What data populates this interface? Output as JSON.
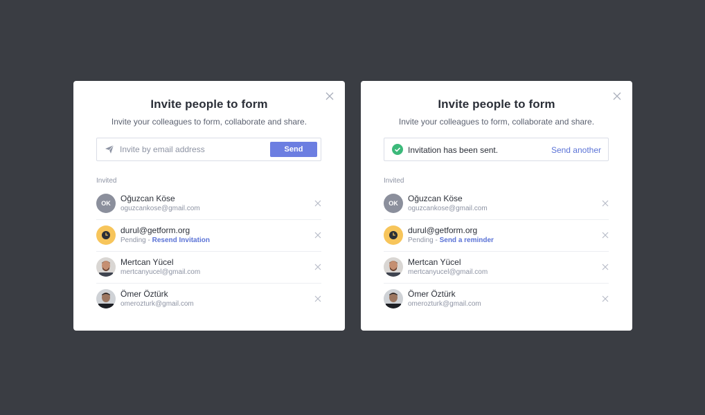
{
  "colors": {
    "background": "#3a3d43",
    "accent": "#6c7ee1",
    "link": "#5b73d6",
    "success": "#3cb97a",
    "pending": "#f7c55b"
  },
  "left_modal": {
    "title": "Invite people to form",
    "subtitle": "Invite your colleagues to form, collaborate and share.",
    "email_placeholder": "Invite by email address",
    "email_value": "",
    "send_label": "Send",
    "invited_label": "Invited",
    "members": [
      {
        "initials": "OK",
        "name": "Oğuzcan Köse",
        "email": "oguzcankose@gmail.com",
        "avatar": "initials"
      },
      {
        "name": "durul@getform.org",
        "status": "Pending",
        "separator": " - ",
        "action": "Resend Invitation",
        "avatar": "clock-icon"
      },
      {
        "name": "Mertcan Yücel",
        "email": "mertcanyucel@gmail.com",
        "avatar": "photo"
      },
      {
        "name": "Ömer Öztürk",
        "email": "omerozturk@gmail.com",
        "avatar": "photo"
      }
    ]
  },
  "right_modal": {
    "title": "Invite people to form",
    "subtitle": "Invite your colleagues to form, collaborate and share.",
    "success_message": "Invitation has been sent.",
    "send_another_label": "Send another",
    "invited_label": "Invited",
    "members": [
      {
        "initials": "OK",
        "name": "Oğuzcan Köse",
        "email": "oguzcankose@gmail.com",
        "avatar": "initials"
      },
      {
        "name": "durul@getform.org",
        "status": "Pending",
        "separator": " - ",
        "action": "Send a reminder",
        "avatar": "clock-icon"
      },
      {
        "name": "Mertcan Yücel",
        "email": "mertcanyucel@gmail.com",
        "avatar": "photo"
      },
      {
        "name": "Ömer Öztürk",
        "email": "omerozturk@gmail.com",
        "avatar": "photo"
      }
    ]
  }
}
